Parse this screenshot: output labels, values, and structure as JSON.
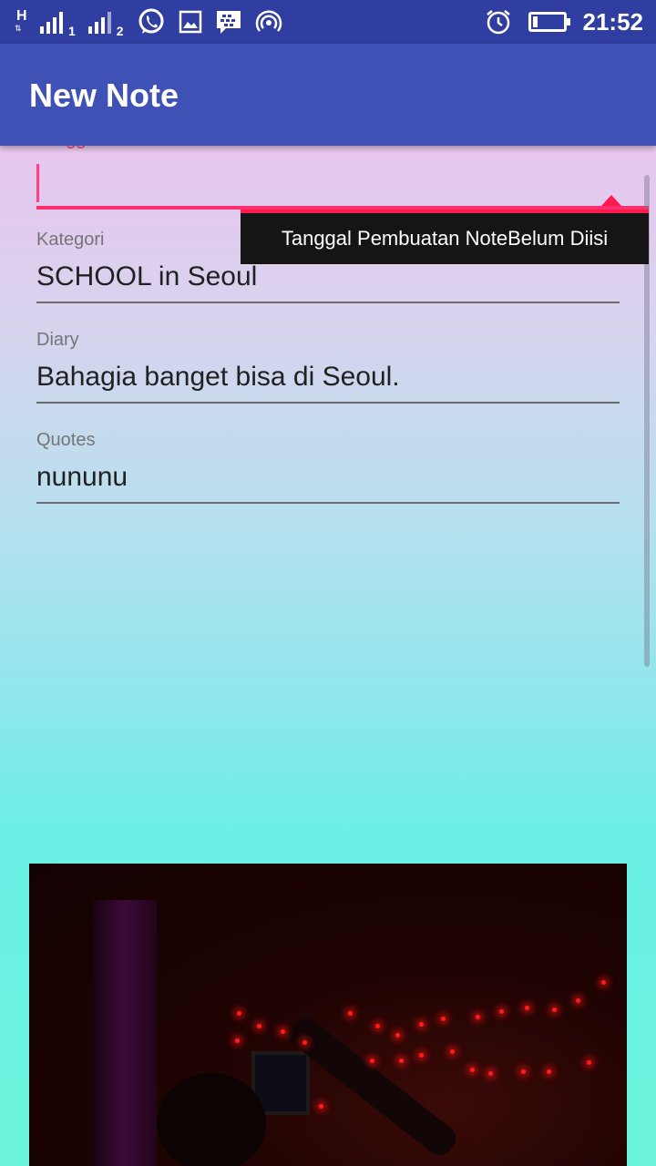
{
  "status_bar": {
    "network_type": "H",
    "sim1_label": "1",
    "sim2_label": "2",
    "time": "21:52",
    "icons": [
      "whatsapp-icon",
      "gallery-icon",
      "bbm-icon",
      "hotspot-icon",
      "alarm-icon",
      "battery-icon"
    ]
  },
  "app_bar": {
    "title": "New Note"
  },
  "form": {
    "date": {
      "label": "Tanggal Pembuatan Note",
      "value": "",
      "error": "Tanggal Pembuatan NoteBelum Diisi"
    },
    "kategori": {
      "label": "Kategori",
      "value": "SCHOOL in Seoul"
    },
    "diary": {
      "label": "Diary",
      "value": "Bahagia banget bisa di Seoul."
    },
    "quotes": {
      "label": "Quotes",
      "value": "nununu"
    }
  },
  "colors": {
    "status_bar": "#2f3ea0",
    "app_bar": "#3f51b5",
    "accent": "#ff4081",
    "error_bg": "#151515"
  }
}
